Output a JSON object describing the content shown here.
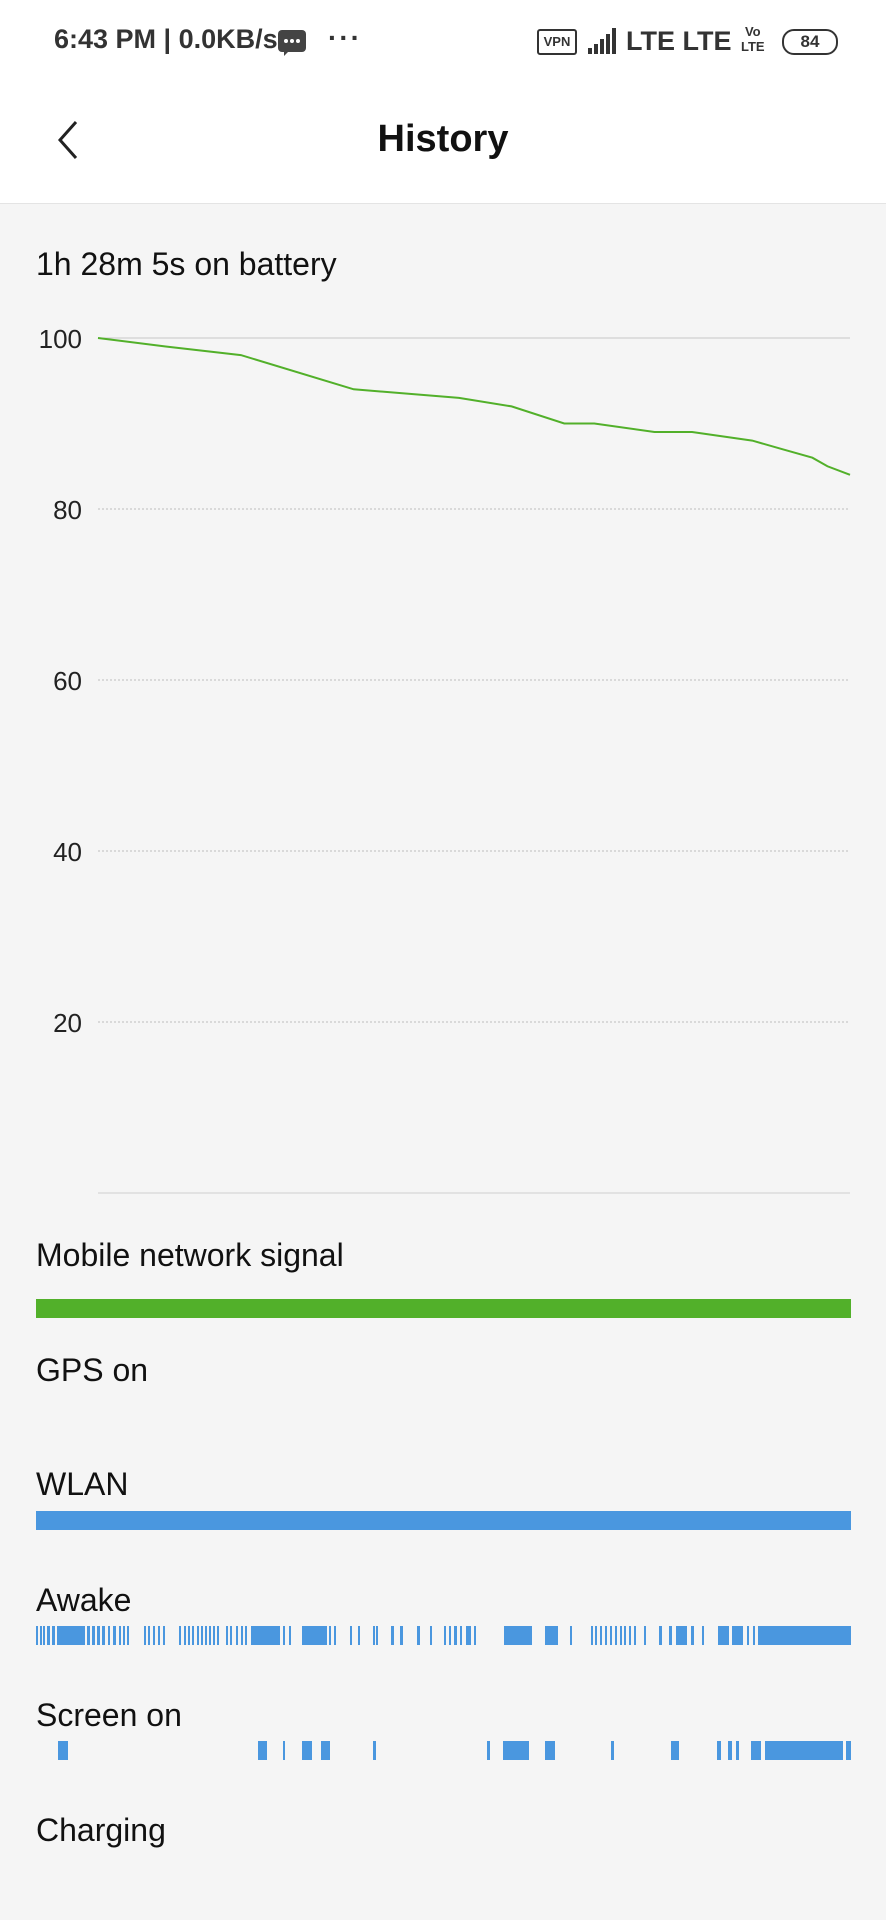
{
  "status_bar": {
    "time": "6:43 PM | 0.0KB/s",
    "more": "···",
    "vpn": "VPN",
    "network": "LTE LTE",
    "volte_top": "Vo",
    "volte_bottom": "LTE",
    "battery": "84",
    "icons": [
      "message-icon",
      "more-icon",
      "vpn-icon",
      "signal-icon",
      "volte-icon",
      "battery-icon"
    ]
  },
  "header": {
    "title": "History",
    "back_icon": "back-arrow-icon"
  },
  "summary": {
    "duration": "1h 28m 5s on battery"
  },
  "chart_data": {
    "type": "line",
    "x": [
      0,
      0.09,
      0.19,
      0.34,
      0.48,
      0.55,
      0.62,
      0.66,
      0.74,
      0.79,
      0.87,
      0.91,
      0.95,
      0.97,
      1.0
    ],
    "series": [
      {
        "values": [
          100,
          99,
          98,
          94,
          93,
          92,
          90,
          90,
          89,
          89,
          88,
          87,
          86,
          85,
          84
        ]
      }
    ],
    "yticks": [
      "100",
      "80",
      "60",
      "40",
      "20"
    ],
    "ylim": [
      0,
      100
    ],
    "color": "#52b02a",
    "grid": true
  },
  "tracks": [
    {
      "label": "Mobile network signal",
      "type": "solid",
      "color": "#52b02a"
    },
    {
      "label": "GPS on",
      "type": "empty",
      "color": "#4a97df"
    },
    {
      "label": "WLAN",
      "type": "solid",
      "color": "#4a97df"
    },
    {
      "label": "Awake",
      "type": "intervals",
      "color": "#4a97df",
      "intervals": [
        [
          0,
          0.002
        ],
        [
          0.005,
          0.007
        ],
        [
          0.009,
          0.011
        ],
        [
          0.014,
          0.017
        ],
        [
          0.02,
          0.023
        ],
        [
          0.026,
          0.06
        ],
        [
          0.063,
          0.066
        ],
        [
          0.069,
          0.072
        ],
        [
          0.075,
          0.078
        ],
        [
          0.081,
          0.085
        ],
        [
          0.088,
          0.091
        ],
        [
          0.095,
          0.098
        ],
        [
          0.102,
          0.104
        ],
        [
          0.107,
          0.109
        ],
        [
          0.112,
          0.114
        ],
        [
          0.132,
          0.134
        ],
        [
          0.137,
          0.14
        ],
        [
          0.144,
          0.146
        ],
        [
          0.15,
          0.152
        ],
        [
          0.156,
          0.158
        ],
        [
          0.176,
          0.178
        ],
        [
          0.181,
          0.183
        ],
        [
          0.186,
          0.189
        ],
        [
          0.192,
          0.194
        ],
        [
          0.197,
          0.199
        ],
        [
          0.202,
          0.204
        ],
        [
          0.207,
          0.209
        ],
        [
          0.212,
          0.214
        ],
        [
          0.217,
          0.219
        ],
        [
          0.222,
          0.224
        ],
        [
          0.233,
          0.235
        ],
        [
          0.238,
          0.24
        ],
        [
          0.246,
          0.248
        ],
        [
          0.251,
          0.253
        ],
        [
          0.257,
          0.259
        ],
        [
          0.264,
          0.3
        ],
        [
          0.303,
          0.305
        ],
        [
          0.311,
          0.313
        ],
        [
          0.326,
          0.357
        ],
        [
          0.36,
          0.362
        ],
        [
          0.366,
          0.368
        ],
        [
          0.385,
          0.387
        ],
        [
          0.395,
          0.397
        ],
        [
          0.413,
          0.416
        ],
        [
          0.417,
          0.419
        ],
        [
          0.436,
          0.439
        ],
        [
          0.447,
          0.45
        ],
        [
          0.468,
          0.471
        ],
        [
          0.483,
          0.486
        ],
        [
          0.501,
          0.503
        ],
        [
          0.507,
          0.509
        ],
        [
          0.513,
          0.517
        ],
        [
          0.52,
          0.522
        ],
        [
          0.528,
          0.534
        ],
        [
          0.537,
          0.539
        ],
        [
          0.574,
          0.609
        ],
        [
          0.625,
          0.64
        ],
        [
          0.655,
          0.658
        ],
        [
          0.681,
          0.683
        ],
        [
          0.686,
          0.688
        ],
        [
          0.692,
          0.694
        ],
        [
          0.698,
          0.7
        ],
        [
          0.704,
          0.706
        ],
        [
          0.71,
          0.712
        ],
        [
          0.716,
          0.718
        ],
        [
          0.722,
          0.724
        ],
        [
          0.728,
          0.73
        ],
        [
          0.734,
          0.736
        ],
        [
          0.746,
          0.749
        ],
        [
          0.765,
          0.768
        ],
        [
          0.777,
          0.78
        ],
        [
          0.785,
          0.799
        ],
        [
          0.804,
          0.807
        ],
        [
          0.817,
          0.82
        ],
        [
          0.837,
          0.85
        ],
        [
          0.854,
          0.868
        ],
        [
          0.873,
          0.875
        ],
        [
          0.88,
          0.882
        ],
        [
          0.886,
          1.0
        ]
      ]
    },
    {
      "label": "Screen on",
      "type": "intervals",
      "color": "#4a97df",
      "intervals": [
        [
          0.027,
          0.039
        ],
        [
          0.273,
          0.284
        ],
        [
          0.303,
          0.306
        ],
        [
          0.326,
          0.339
        ],
        [
          0.35,
          0.361
        ],
        [
          0.414,
          0.417
        ],
        [
          0.553,
          0.557
        ],
        [
          0.573,
          0.605
        ],
        [
          0.624,
          0.637
        ],
        [
          0.706,
          0.709
        ],
        [
          0.779,
          0.789
        ],
        [
          0.836,
          0.84
        ],
        [
          0.849,
          0.854
        ],
        [
          0.859,
          0.863
        ],
        [
          0.877,
          0.889
        ],
        [
          0.894,
          0.99
        ],
        [
          0.994,
          1.0
        ]
      ]
    },
    {
      "label": "Charging",
      "type": "empty",
      "color": "#4a97df"
    }
  ]
}
